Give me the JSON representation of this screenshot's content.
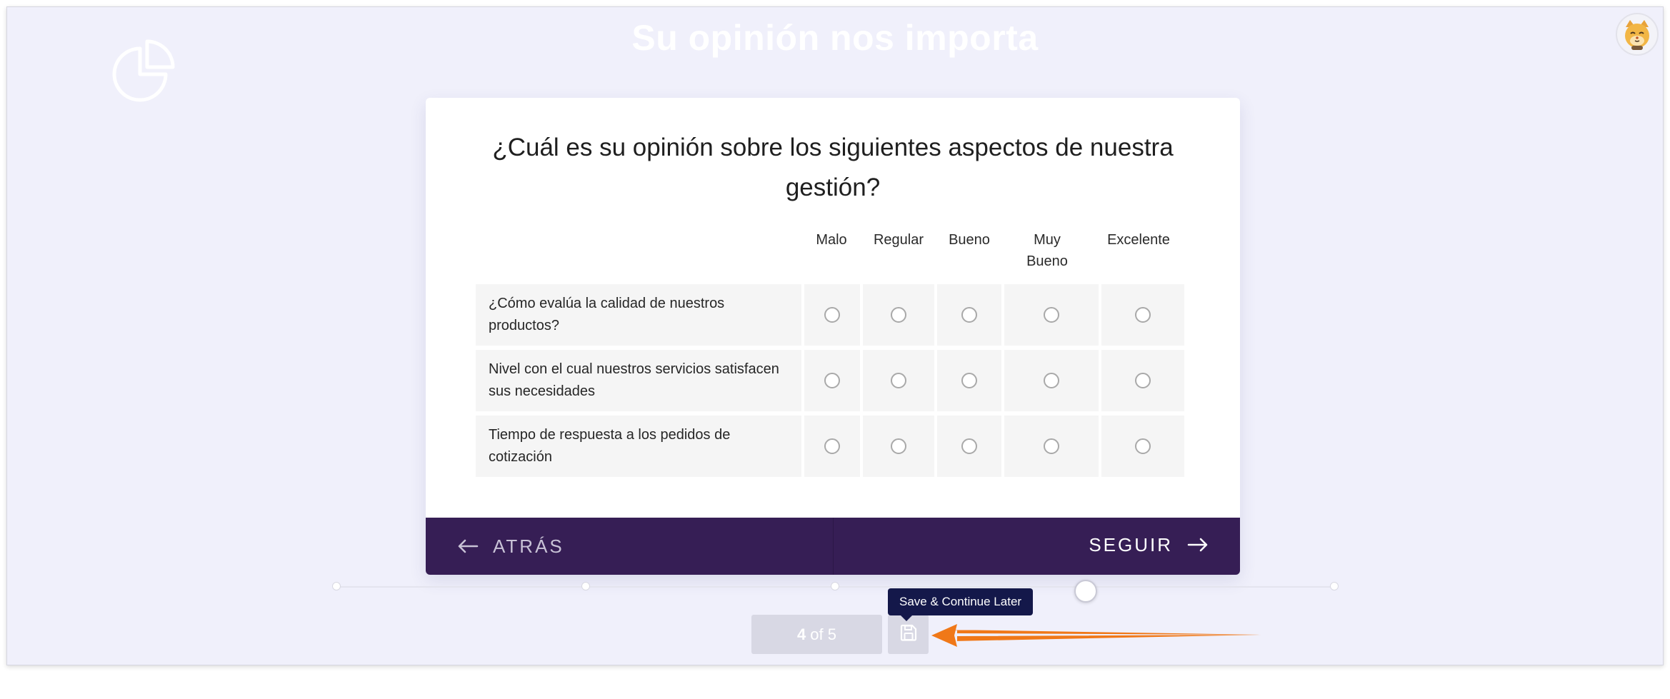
{
  "header": {
    "title": "Su opinión nos importa"
  },
  "survey": {
    "question": "¿Cuál es su opinión sobre los siguientes aspectos de nuestra gestión?",
    "columns": [
      "Malo",
      "Regular",
      "Bueno",
      "Muy Bueno",
      "Excelente"
    ],
    "rows": [
      "¿Cómo evalúa la calidad de nuestros productos?",
      "Nivel con el cual nuestros servicios satisfacen sus necesidades",
      "Tiempo de respuesta a los pedidos de cotización"
    ]
  },
  "navigation": {
    "back_label": "ATRÁS",
    "next_label": "SEGUIR"
  },
  "progress": {
    "current": "4",
    "of_label": "of 5",
    "fraction": 0.75
  },
  "save": {
    "tooltip": "Save & Continue Later",
    "icon": "floppy-disk-icon"
  },
  "colors": {
    "background": "#f0f0fb",
    "nav_bar": "#361e55",
    "tooltip": "#14184a",
    "annotation_arrow": "#f07818"
  }
}
